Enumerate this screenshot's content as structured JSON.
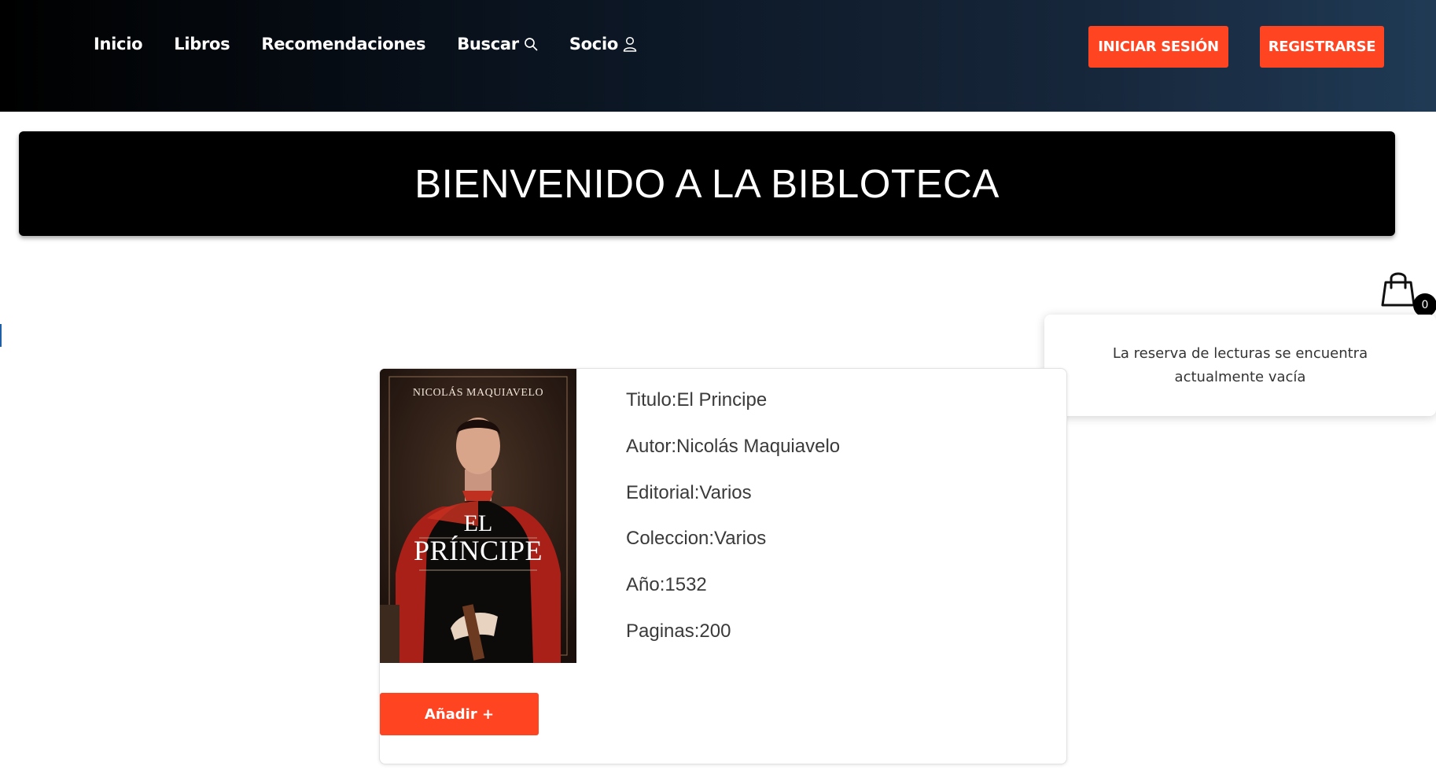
{
  "nav": {
    "links": [
      "Inicio",
      "Libros",
      "Recomendaciones",
      "Buscar",
      "Socio"
    ],
    "login_label": "INICIAR SESIÓN",
    "register_label": "REGISTRARSE"
  },
  "hero": {
    "title": "BIENVENIDO A LA BIBLOTECA"
  },
  "cart": {
    "count": "0",
    "empty_message": "La reserva de lecturas se encuentra actualmente vacía"
  },
  "book": {
    "cover": {
      "author": "NICOLÁS MAQUIAVELO",
      "title_line1": "EL",
      "title_line2": "PRÍNCIPE"
    },
    "details": [
      "Titulo:El Principe",
      "Autor:Nicolás Maquiavelo",
      "Editorial:Varios",
      "Coleccion:Varios",
      "Año:1532",
      "Paginas:200"
    ],
    "add_label": "Añadir +"
  },
  "colors": {
    "accent": "#ff4422",
    "hero_bg": "#000000",
    "nav_gradient_end": "#203a55"
  }
}
